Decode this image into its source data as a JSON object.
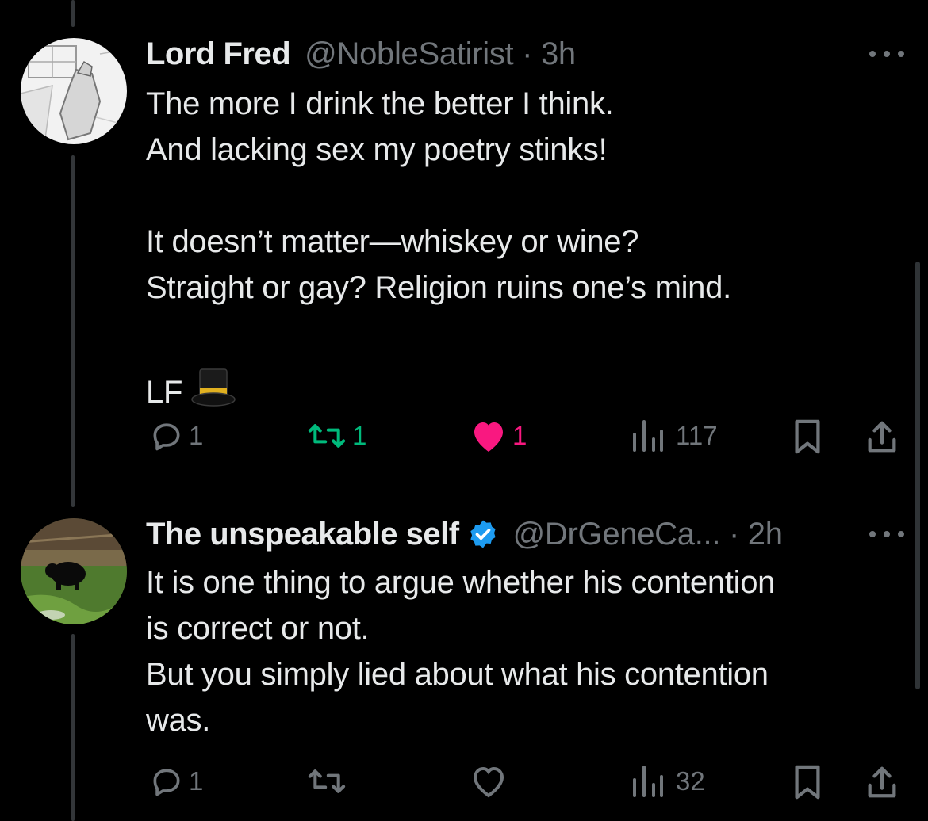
{
  "tweets": [
    {
      "name": "Lord Fred",
      "handle": "@NobleSatirist · 3h",
      "lines": [
        "The more I drink the better I think.",
        "And lacking sex my poetry stinks!",
        "",
        "It doesn’t matter—whiskey or wine?",
        "Straight or gay? Religion ruins one’s mind.",
        "",
        "LF"
      ],
      "hat_icon": "top-hat-emoji",
      "replies": "1",
      "reposts": "1",
      "likes": "1",
      "views": "117"
    },
    {
      "name": "The unspeakable self",
      "handle": "@DrGeneCa... · 2h",
      "verified": true,
      "lines": [
        "It is one thing to argue whether his contention",
        "is correct or not.",
        "But you simply lied about what his contention",
        "was."
      ],
      "replies": "1",
      "views": "32"
    }
  ],
  "colors": {
    "background": "#000000",
    "text": "#e7e9ea",
    "muted": "#71767b",
    "repost_active": "#00ba7c",
    "like_active": "#f91880",
    "verified": "#1d9bf0"
  }
}
